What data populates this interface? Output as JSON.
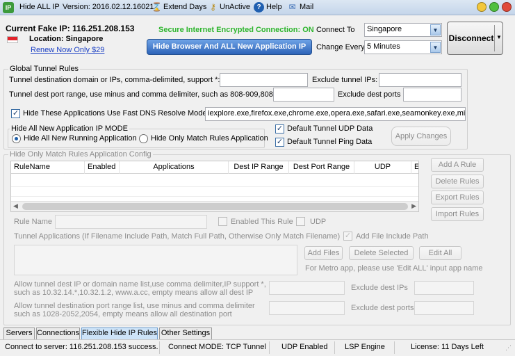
{
  "titlebar": {
    "app_title": "Hide ALL IP",
    "version": "Version: 2016.02.12.160212",
    "extend_days": "Extend Days",
    "unactive": "UnActive",
    "help": "Help",
    "mail": "Mail",
    "app_icon_text": "IP"
  },
  "header": {
    "fake_ip_label": "Current Fake IP: 116.251.208.153",
    "location": "Location: Singapore",
    "renew": "Renew Now Only $29",
    "secure_status": "Secure Internet Encrypted Connection: ON",
    "hide_browser_button": "Hide Browser And ALL New Application IP",
    "connect_to_label": "Connect To",
    "connect_to_value": "Singapore",
    "change_every_label": "Change Every",
    "change_every_value": "5 Minutes",
    "disconnect_button": "Disconnect",
    "status_color": "#2db52d",
    "accent_color": "#2d63b8"
  },
  "global_rules": {
    "legend": "Global Tunnel Rules",
    "dest_label": "Tunnel destination domain or IPs, comma-delimited, support *:",
    "dest_value": "",
    "exclude_ips_label": "Exclude tunnel IPs:",
    "exclude_ips_value": "",
    "port_label": "Tunnel dest port range, use minus and comma delimiter, such as 808-909,8080",
    "port_value": "",
    "exclude_ports_label": "Exclude dest ports",
    "exclude_ports_value": "",
    "hide_dns_label": "Hide These Applications Use Fast DNS Resolve Mode",
    "hide_dns_checked": true,
    "dns_apps_value": "iexplore.exe,firefox.exe,chrome.exe,opera.exe,safari.exe,seamonkey.exe,micr",
    "mode_legend": "Hide All New Application IP MODE",
    "mode_all": "Hide All New Running Application",
    "mode_match": "Hide Only Match Rules Application",
    "mode_selected": "all",
    "default_udp": "Default Tunnel UDP Data",
    "default_udp_checked": true,
    "default_ping": "Default Tunnel Ping Data",
    "default_ping_checked": true,
    "apply_button": "Apply Changes"
  },
  "match_rules": {
    "legend": "Hide Only Match Rules Application Config",
    "columns": [
      "RuleName",
      "Enabled",
      "Applications",
      "Dest IP Range",
      "Dest Port Range",
      "UDP",
      "E"
    ],
    "rows": [],
    "add_rule": "Add A Rule",
    "delete_rules": "Delete Rules",
    "export_rules": "Export Rules",
    "import_rules": "Import Rules",
    "rule_name_label": "Rule Name",
    "enabled_rule_label": "Enabled This Rule",
    "udp_label": "UDP",
    "tunnel_apps_label": "Tunnel Applications (If Filename Include Path, Match Full Path, Otherwise Only Match Filename)",
    "add_file_path_label": "Add File Include Path",
    "add_file_path_checked": true,
    "add_files": "Add Files",
    "delete_selected": "Delete Selected",
    "edit_all": "Edit All",
    "metro_note": "For Metro app, please use 'Edit ALL' input app name",
    "allow_ip_label_1": "Allow tunnel dest IP or domain name list,use comma delimiter,IP support *,",
    "allow_ip_label_2": "such as 10.32.14.*,10.32.1.2, www.a.cc, empty means allow all dest IP",
    "exclude_dest_ips": "Exclude dest IPs",
    "allow_port_label_1": "Allow tunnel destination port range list, use minus and comma delimiter",
    "allow_port_label_2": "such as 1028-2052,2054, empty means allow all destination port",
    "exclude_dest_ports": "Exclude dest ports"
  },
  "tabs": [
    {
      "label": "Servers"
    },
    {
      "label": "Connections"
    },
    {
      "label": "Flexible Hide IP Rules"
    },
    {
      "label": "Other Settings"
    }
  ],
  "active_tab": "Flexible Hide IP Rules",
  "statusbar": {
    "connect": "Connect to server: 116.251.208.153 success.",
    "mode": "Connect MODE: TCP Tunnel",
    "udp": "UDP Enabled",
    "engine": "LSP Engine",
    "license": "License: 11 Days Left"
  }
}
